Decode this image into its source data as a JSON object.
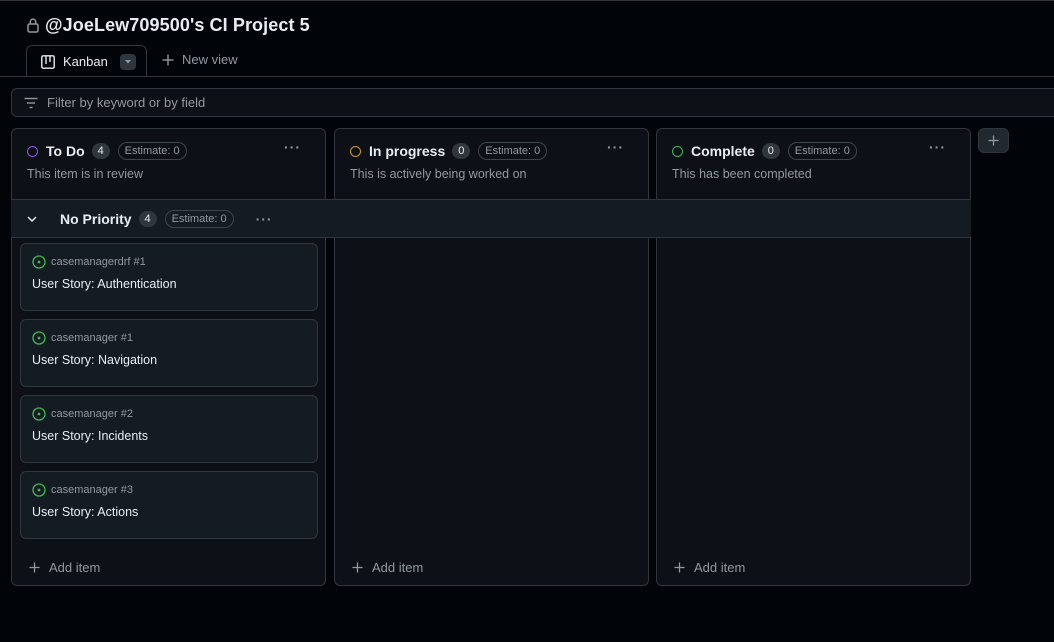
{
  "project": {
    "title": "@JoeLew709500's CI Project 5"
  },
  "views": {
    "active_tab": "Kanban",
    "new_view_label": "New view"
  },
  "filter": {
    "placeholder": "Filter by keyword or by field"
  },
  "columns": [
    {
      "name": "To Do",
      "count": "4",
      "estimate": "Estimate: 0",
      "description": "This item is in review",
      "status_color": "#8957e5",
      "add_label": "Add item"
    },
    {
      "name": "In progress",
      "count": "0",
      "estimate": "Estimate: 0",
      "description": "This is actively being worked on",
      "status_color": "#d29922",
      "add_label": "Add item"
    },
    {
      "name": "Complete",
      "count": "0",
      "estimate": "Estimate: 0",
      "description": "This has been completed",
      "status_color": "#3fb950",
      "add_label": "Add item"
    }
  ],
  "group": {
    "name": "No Priority",
    "count": "4",
    "estimate": "Estimate: 0"
  },
  "cards": [
    {
      "ref": "casemanagerdrf #1",
      "title": "User Story: Authentication"
    },
    {
      "ref": "casemanager #1",
      "title": "User Story: Navigation"
    },
    {
      "ref": "casemanager #2",
      "title": "User Story: Incidents"
    },
    {
      "ref": "casemanager #3",
      "title": "User Story: Actions"
    }
  ],
  "icons": {
    "lock": "lock-icon",
    "kanban": "table-icon",
    "filter": "filter-icon",
    "issue_open": "issue-opened-icon",
    "plus": "plus-icon",
    "more": "kebab-horizontal-icon"
  },
  "colors": {
    "issue_open": "#3fb950",
    "background": "#010409",
    "column_bg": "#0d1117"
  }
}
